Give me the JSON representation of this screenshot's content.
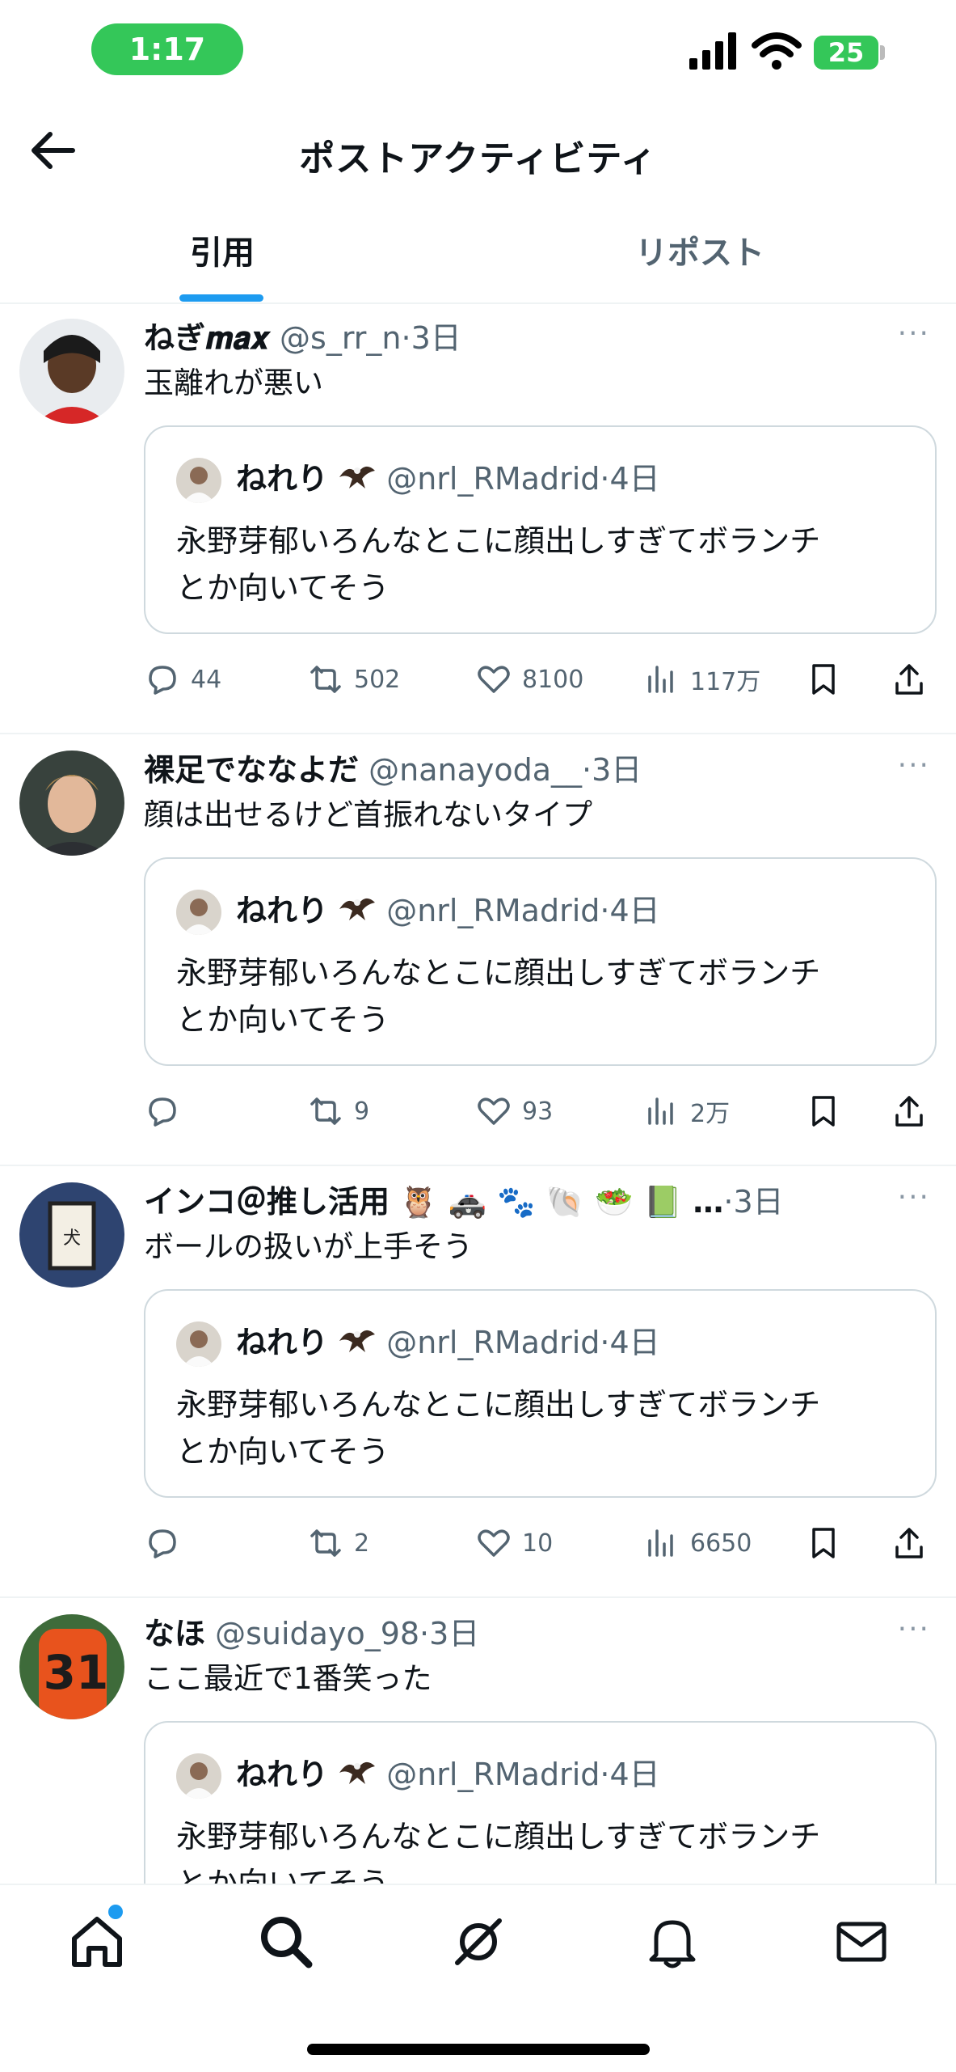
{
  "status_bar": {
    "time": "1:17",
    "battery": "25"
  },
  "header": {
    "title": "ポストアクティビティ"
  },
  "tabs": [
    {
      "label": "引用",
      "active": true
    },
    {
      "label": "リポスト",
      "active": false
    }
  ],
  "quoted_post": {
    "name": "ねれり",
    "handle": "@nrl_RMadrid",
    "time": "4日",
    "text_line1": "永野芽郁いろんなとこに顔出しすぎてボランチ",
    "text_line2": "とか向いてそう"
  },
  "posts": [
    {
      "name": "ねぎ𝒎𝒂𝒙",
      "handle": "@s_rr_n",
      "time": "3日",
      "text": "玉離れが悪い",
      "replies": "44",
      "reposts": "502",
      "likes": "8100",
      "views": "117万"
    },
    {
      "name": "裸足でななよだ",
      "handle": "@nanayoda__",
      "time": "3日",
      "text": "顔は出せるけど首振れないタイプ",
      "replies": "",
      "reposts": "9",
      "likes": "93",
      "views": "2万"
    },
    {
      "name": "インコ＠推し活用",
      "name_emoji": "🦉 🚓 🐾 🐚 🥗 📗 …",
      "handle": "",
      "time": "3日",
      "text": "ボールの扱いが上手そう",
      "replies": "",
      "reposts": "2",
      "likes": "10",
      "views": "6650"
    },
    {
      "name": "なほ",
      "handle": "@suidayo_98",
      "time": "3日",
      "text": "ここ最近で1番笑った",
      "replies": "",
      "reposts": "",
      "likes": "",
      "views": ""
    }
  ],
  "separator": "·",
  "more": "···",
  "icons": [
    "back-arrow-icon",
    "signal-icon",
    "wifi-icon",
    "battery-icon",
    "reply-icon",
    "repost-icon",
    "heart-icon",
    "views-icon",
    "bookmark-icon",
    "share-icon",
    "home-icon",
    "search-icon",
    "grok-icon",
    "bell-icon",
    "mail-icon"
  ],
  "colors": {
    "accent": "#1d9bf0",
    "status_green": "#34c759",
    "muted": "#536471",
    "border": "#cfd9de"
  }
}
